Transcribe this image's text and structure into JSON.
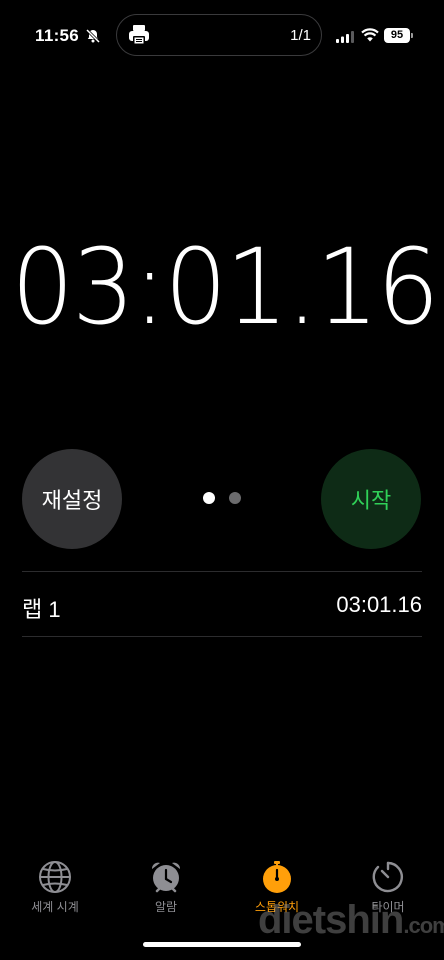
{
  "status_bar": {
    "time": "11:56",
    "silent_icon": "bell-slash-icon",
    "live_activity": {
      "icon": "printer-icon",
      "count": "1/1"
    },
    "signal_icon": "cellular-signal-icon",
    "wifi_icon": "wifi-icon",
    "battery_level": "95"
  },
  "stopwatch": {
    "display": "03:01.16"
  },
  "controls": {
    "reset_label": "재설정",
    "start_label": "시작",
    "reset_color": "#333335",
    "start_color": "#0e2b16",
    "start_text_color": "#30d158",
    "page_dots": 2,
    "active_page": 1
  },
  "laps": [
    {
      "label": "랩 1",
      "time": "03:01.16"
    }
  ],
  "tab_bar": {
    "items": [
      {
        "label": "세계 시계",
        "icon": "globe-icon",
        "active": false
      },
      {
        "label": "알람",
        "icon": "alarm-clock-icon",
        "active": false
      },
      {
        "label": "스톱워치",
        "icon": "stopwatch-icon",
        "active": true
      },
      {
        "label": "타이머",
        "icon": "timer-icon",
        "active": false
      }
    ],
    "active_color": "#ff9f0a",
    "inactive_color": "#8e8e93"
  },
  "watermark": {
    "text": "dietshin",
    "suffix": ".com"
  }
}
